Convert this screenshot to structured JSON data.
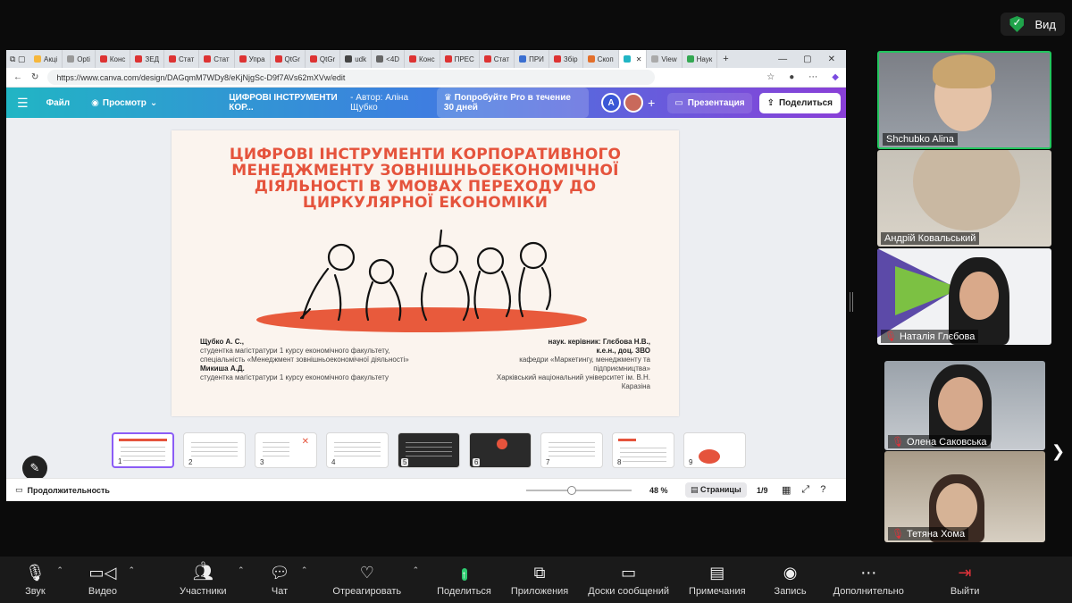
{
  "topbar": {
    "view_label": "Вид"
  },
  "browser": {
    "tabs": [
      "Акці",
      "Opti",
      "Конс",
      "ЗЕД",
      "Стат",
      "Стат",
      "Упра",
      "QtGr",
      "QtGr",
      "udk",
      "<4D",
      "Конс",
      "ПРЕС",
      "Стат",
      "ПРИ",
      "Збір",
      "Скоп",
      "",
      "View",
      "Наук"
    ],
    "url": "https://www.canva.com/design/DAGqmM7WDy8/eKjNjgSc-D9f7AVs62mXVw/edit"
  },
  "canva": {
    "file_label": "Файл",
    "view_label": "Просмотр",
    "doc_title": "ЦИФРОВІ ІНСТРУМЕНТИ КОР...",
    "author": "- Автор: Аліна Щубко",
    "pro_button": "Попробуйте Pro в течение 30 дней",
    "avatar_letter": "A",
    "present_button": "Презентация",
    "share_button": "Поделиться"
  },
  "slide": {
    "title": "ЦИФРОВІ  ІНСТРУМЕНТИ КОРПОРАТИВНОГО МЕНЕДЖМЕНТУ ЗОВНІШНЬОЕКОНОМІЧНОЇ ДІЯЛЬНОСТІ В УМОВАХ ПЕРЕХОДУ ДО ЦИРКУЛЯРНОЇ ЕКОНОМІКИ",
    "left_name1": "Щубко А. С.,",
    "left_line1": "студентка магістратури 1 курсу економічного факультету,",
    "left_line2": "спеціальність «Менеджмент зовнішньоекономічної діяльності»",
    "left_name2": "Микиша А.Д.",
    "left_line3": "студентка магістратури 1 курсу економічного факультету",
    "right_name": "наук. керівник: Глєбова Н.В.,",
    "right_line1": "к.е.н., доц. ЗВО",
    "right_line2": "кафедри «Маркетингу, менеджменту та",
    "right_line3": "підприємництва»",
    "right_line4": "Харківський національний університет ім. В.Н.",
    "right_line5": "Каразіна",
    "accent": "#e5533c"
  },
  "thumbnails": [
    "1",
    "2",
    "3",
    "4",
    "5",
    "6",
    "7",
    "8",
    "9"
  ],
  "statusbar": {
    "duration": "Продолжительность",
    "zoom": "48 %",
    "pages": "Страницы",
    "pagecount": "1/9"
  },
  "participants": [
    {
      "name": "Shchubko Alina",
      "muted": false
    },
    {
      "name": "Андрій Ковальський",
      "muted": false
    },
    {
      "name": "Наталія Глєбова",
      "muted": true
    },
    {
      "name": "Олена Саковська",
      "muted": true
    },
    {
      "name": "Тетяна Хома",
      "muted": true
    }
  ],
  "toolbar": {
    "audio": "Звук",
    "video": "Видео",
    "participants": "Участники",
    "participants_count": "9",
    "chat": "Чат",
    "react": "Отреагировать",
    "share": "Поделиться",
    "apps": "Приложения",
    "whiteboards": "Доски сообщений",
    "notes": "Примечания",
    "record": "Запись",
    "more": "Дополнительно",
    "leave": "Выйти"
  }
}
